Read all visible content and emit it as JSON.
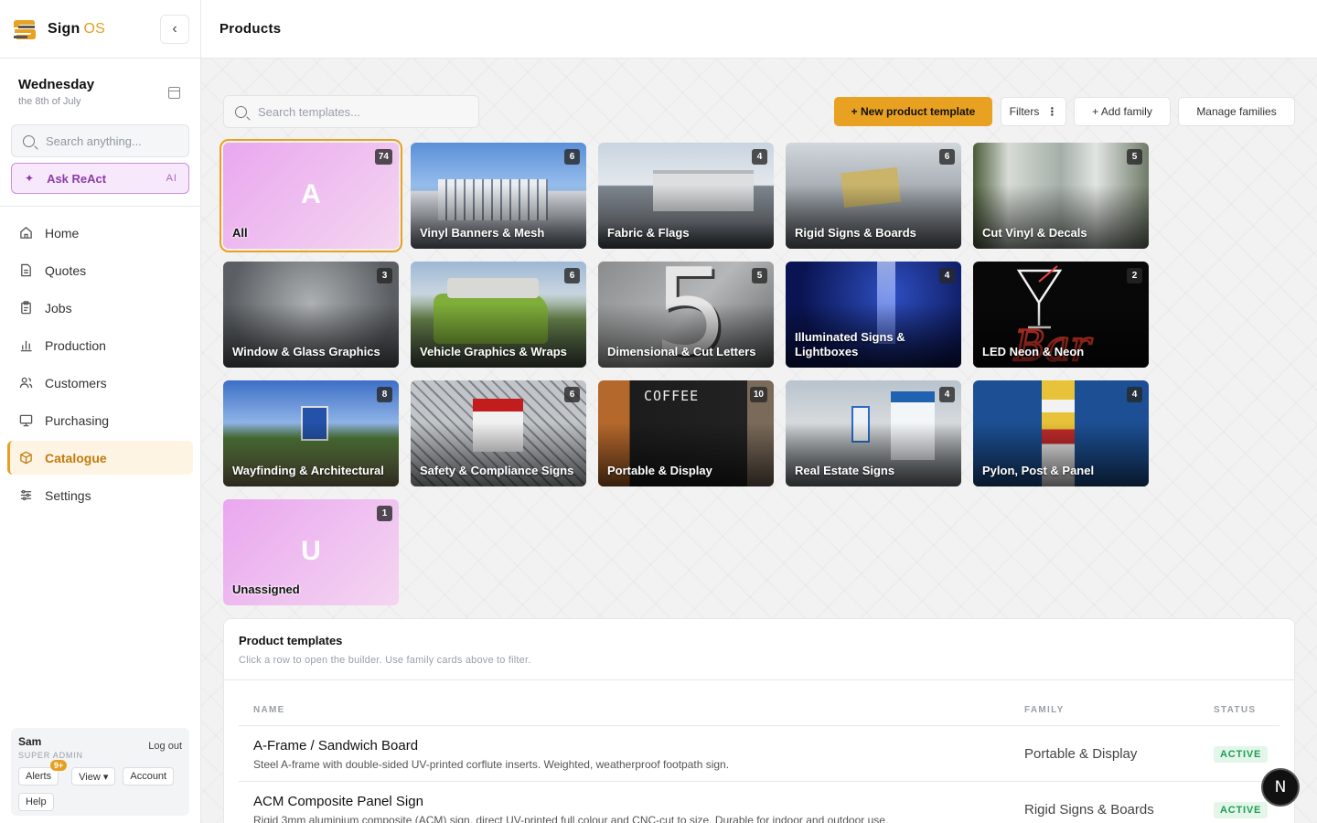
{
  "app": {
    "name": "Sign",
    "name_suffix": "OS",
    "accent": "#e8a120"
  },
  "page": {
    "title": "Products"
  },
  "sidebar": {
    "collapse_icon": "chevron-left-icon",
    "date": {
      "day": "Wednesday",
      "sub": "the 8th of July"
    },
    "search": {
      "placeholder": "Search anything..."
    },
    "ask": {
      "label": "Ask ReAct",
      "tag": "AI"
    },
    "items": [
      {
        "label": "Home",
        "icon": "home-icon"
      },
      {
        "label": "Quotes",
        "icon": "document-icon"
      },
      {
        "label": "Jobs",
        "icon": "clipboard-icon"
      },
      {
        "label": "Production",
        "icon": "bar-chart-icon"
      },
      {
        "label": "Customers",
        "icon": "users-icon"
      },
      {
        "label": "Purchasing",
        "icon": "monitor-icon"
      },
      {
        "label": "Catalogue",
        "icon": "box-icon",
        "active": true
      },
      {
        "label": "Settings",
        "icon": "sliders-icon"
      }
    ],
    "user": {
      "name": "Sam",
      "role": "SUPER ADMIN",
      "logout": "Log out",
      "alerts": "Alerts",
      "alerts_badge": "9+",
      "view": "View ▾",
      "account": "Account",
      "help": "Help"
    }
  },
  "toolbar": {
    "search_placeholder": "Search templates...",
    "new_template": "+ New product template",
    "filters": "Filters",
    "add_family": "+ Add family",
    "manage_families": "Manage families"
  },
  "families": [
    {
      "label": "All",
      "count": "74",
      "letter": "A"
    },
    {
      "label": "Vinyl Banners & Mesh",
      "count": "6"
    },
    {
      "label": "Fabric & Flags",
      "count": "4"
    },
    {
      "label": "Rigid Signs & Boards",
      "count": "6"
    },
    {
      "label": "Cut Vinyl & Decals",
      "count": "5"
    },
    {
      "label": "Window & Glass Graphics",
      "count": "3"
    },
    {
      "label": "Vehicle Graphics & Wraps",
      "count": "6"
    },
    {
      "label": "Dimensional & Cut Letters",
      "count": "5"
    },
    {
      "label": "Illuminated Signs & Lightboxes",
      "count": "4"
    },
    {
      "label": "LED Neon & Neon",
      "count": "2"
    },
    {
      "label": "Wayfinding & Architectural",
      "count": "8"
    },
    {
      "label": "Safety & Compliance Signs",
      "count": "6"
    },
    {
      "label": "Portable & Display",
      "count": "10"
    },
    {
      "label": "Real Estate Signs",
      "count": "4"
    },
    {
      "label": "Pylon, Post & Panel",
      "count": "4"
    },
    {
      "label": "Unassigned",
      "count": "1",
      "letter": "U"
    }
  ],
  "templates": {
    "title": "Product templates",
    "subtitle": "Click a row to open the builder. Use family cards above to filter.",
    "columns": {
      "name": "NAME",
      "family": "FAMILY",
      "status": "STATUS"
    },
    "rows": [
      {
        "name": "A-Frame / Sandwich Board",
        "desc": "Steel A-frame with double-sided UV-printed corflute inserts. Weighted, weatherproof footpath sign.",
        "family": "Portable & Display",
        "status": "ACTIVE"
      },
      {
        "name": "ACM Composite Panel Sign",
        "desc": "Rigid 3mm aluminium composite (ACM) sign, direct UV-printed full colour and CNC-cut to size. Durable for indoor and outdoor use.",
        "family": "Rigid Signs & Boards",
        "status": "ACTIVE"
      }
    ]
  },
  "fab": {
    "label": "N"
  }
}
